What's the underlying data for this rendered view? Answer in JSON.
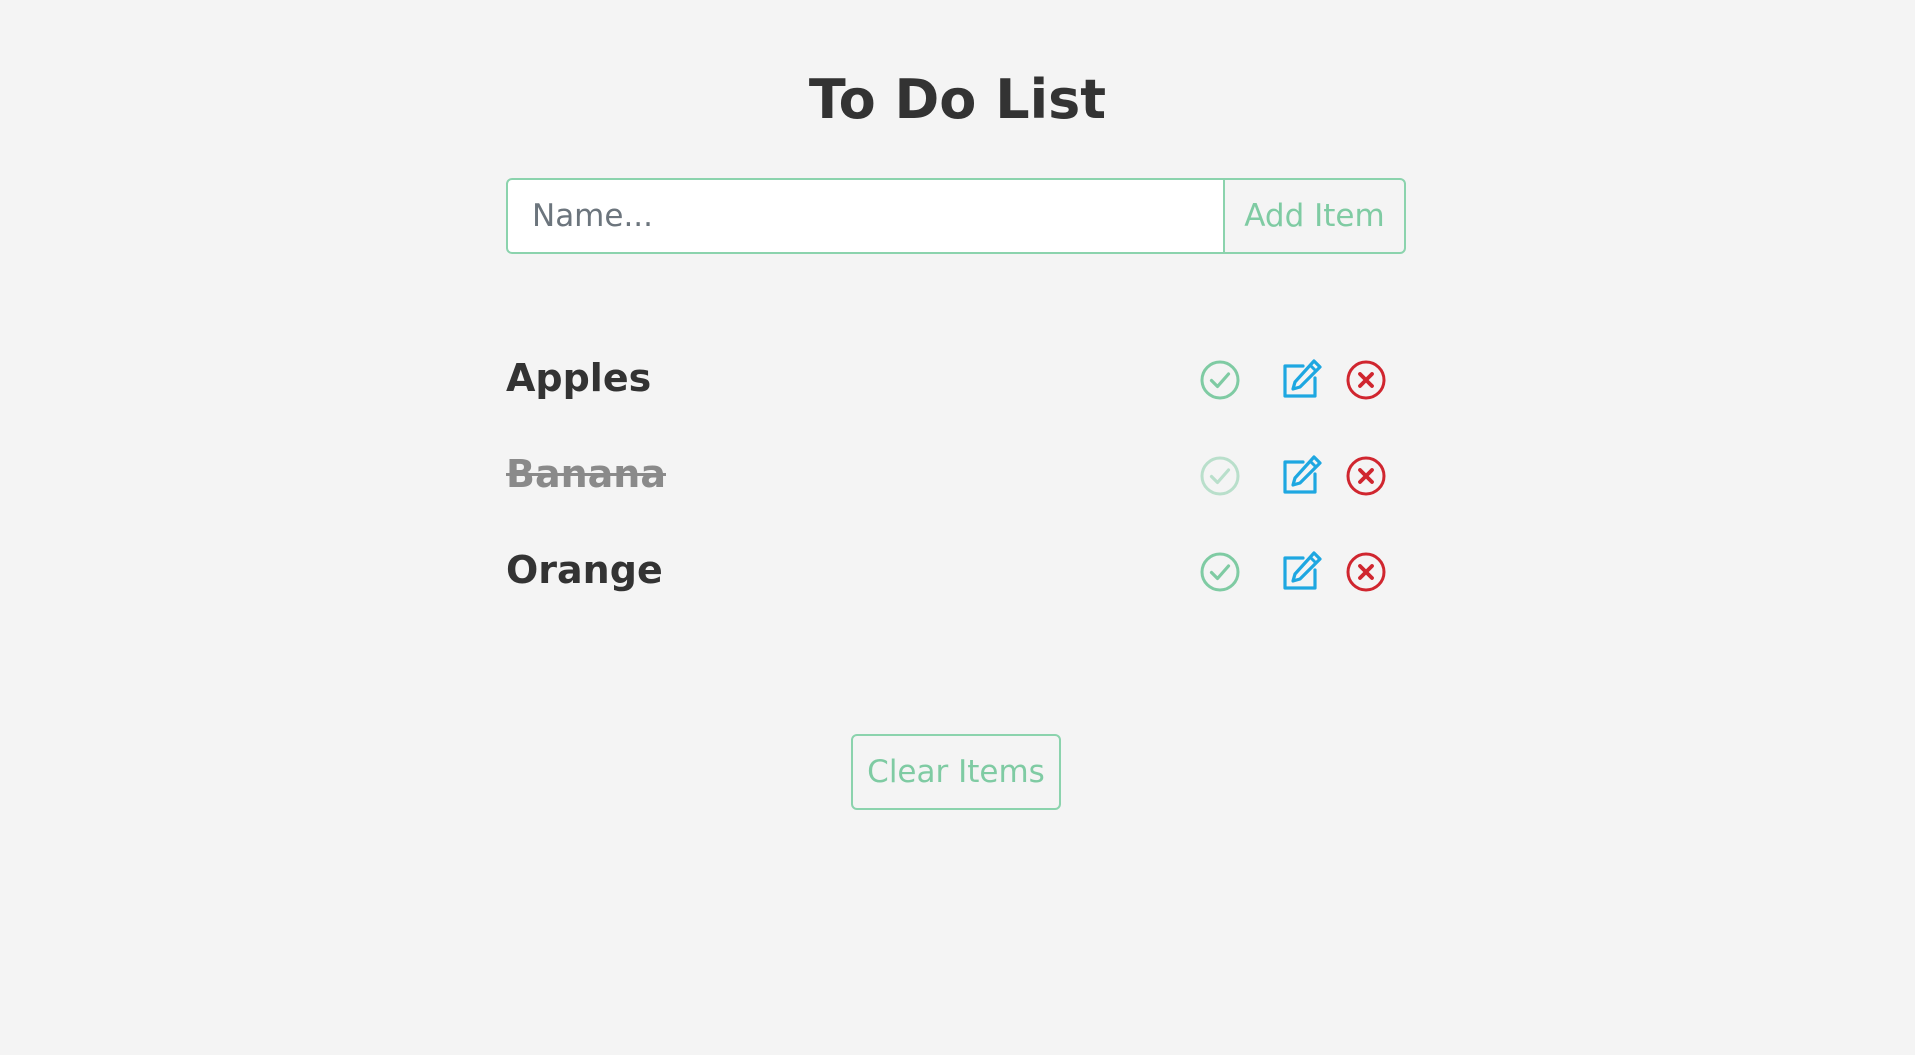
{
  "page": {
    "title": "To Do List"
  },
  "form": {
    "input_value": "",
    "input_placeholder": "Name...",
    "add_label": "Add Item"
  },
  "items": [
    {
      "label": "Apples",
      "completed": false
    },
    {
      "label": "Banana",
      "completed": true
    },
    {
      "label": "Orange",
      "completed": false
    }
  ],
  "actions": {
    "clear_label": "Clear Items"
  },
  "icons": {
    "complete": "check-circle-icon",
    "edit": "edit-icon",
    "delete": "x-circle-icon"
  },
  "colors": {
    "background": "#f4f4f4",
    "accent_green": "#7fcba3",
    "edit_blue": "#1ea7e1",
    "delete_red": "#d0262f",
    "text": "#333333",
    "completed_text": "#8a8a8a"
  }
}
